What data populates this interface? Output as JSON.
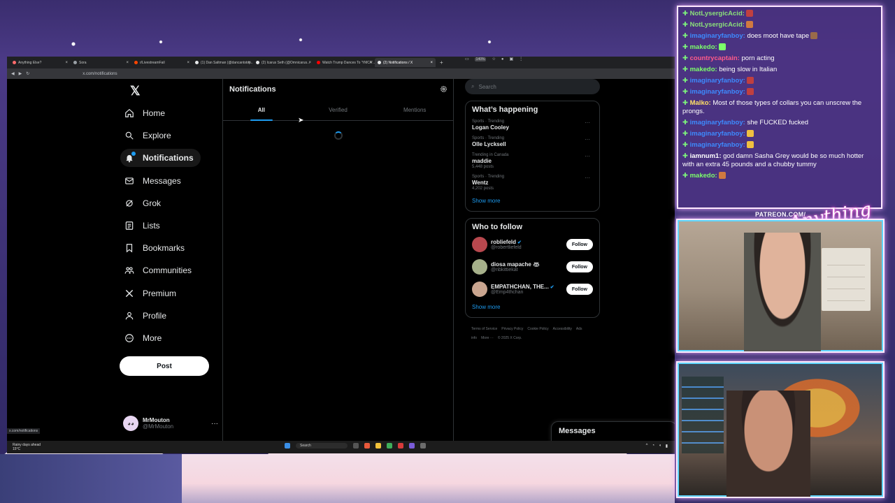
{
  "browser": {
    "tabs": [
      {
        "label": "Anything Else?",
        "color": "#ff6b6b"
      },
      {
        "label": "Sora",
        "color": "#9aa0a6"
      },
      {
        "label": "r/LivestreamFail",
        "color": "#ff4500"
      },
      {
        "label": "(1) Dan Saltman (@dancantstop...",
        "color": "#e7e9ea"
      },
      {
        "label": "(2) Icarus Seth (@Omnicarus...",
        "color": "#e7e9ea"
      },
      {
        "label": "Watch Trump Dances To 'YMCA'...",
        "color": "#ff0000"
      },
      {
        "label": "(2) Notifications / X",
        "color": "#e7e9ea",
        "active": true
      }
    ],
    "url": "x.com/notifications",
    "zoom": "140%",
    "status_url": "x.com/notifications"
  },
  "nav": {
    "items": [
      {
        "label": "Home",
        "icon": "home-icon"
      },
      {
        "label": "Explore",
        "icon": "search-icon"
      },
      {
        "label": "Notifications",
        "icon": "bell-icon",
        "active": true,
        "badge": "2"
      },
      {
        "label": "Messages",
        "icon": "envelope-icon"
      },
      {
        "label": "Grok",
        "icon": "grok-icon"
      },
      {
        "label": "Lists",
        "icon": "list-icon"
      },
      {
        "label": "Bookmarks",
        "icon": "bookmark-icon"
      },
      {
        "label": "Communities",
        "icon": "people-icon"
      },
      {
        "label": "Premium",
        "icon": "x-icon"
      },
      {
        "label": "Profile",
        "icon": "person-icon"
      },
      {
        "label": "More",
        "icon": "more-circle-icon"
      }
    ],
    "post_label": "Post",
    "profile": {
      "name": "MrMouton",
      "handle": "@MrMouton"
    }
  },
  "main": {
    "title": "Notifications",
    "tabs": [
      "All",
      "Verified",
      "Mentions"
    ]
  },
  "right": {
    "search_placeholder": "Search",
    "whats_happening": {
      "title": "What’s happening",
      "trends": [
        {
          "meta": "Sports · Trending",
          "name": "Logan Cooley",
          "count": ""
        },
        {
          "meta": "Sports · Trending",
          "name": "Olle Lycksell",
          "count": ""
        },
        {
          "meta": "Trending in Canada",
          "name": "maddie",
          "count": "5,448 posts"
        },
        {
          "meta": "Sports · Trending",
          "name": "Wentz",
          "count": "4,202 posts"
        }
      ],
      "show_more": "Show more"
    },
    "who_to_follow": {
      "title": "Who to follow",
      "accounts": [
        {
          "name": "robliefeld",
          "handle": "@robertliefeld",
          "verified": true,
          "color": "#b8484e"
        },
        {
          "name": "diosa mapache 🦝",
          "handle": "@nbkittiekat",
          "verified": false,
          "color": "#a6b08a"
        },
        {
          "name": "EMPATHCHAN, THE...",
          "handle": "@Emp4thchan",
          "verified": true,
          "color": "#c9a58f"
        }
      ],
      "follow_label": "Follow",
      "show_more": "Show more"
    },
    "footer": [
      "Terms of Service",
      "Privacy Policy",
      "Cookie Policy",
      "Accessibility",
      "Ads info",
      "More ···",
      "© 2025 X Corp."
    ]
  },
  "messages_drawer": "Messages",
  "taskbar": {
    "weather_line1": "Rainy days ahead",
    "weather_line2": "15°C",
    "search": "Search"
  },
  "chat": [
    {
      "user": "NotLysergicAcid:",
      "text": "",
      "color": "#8be07a",
      "emote": "#c04040"
    },
    {
      "user": "NotLysergicAcid:",
      "text": "",
      "color": "#8be07a",
      "emote": "#d07a40"
    },
    {
      "user": "imaginaryfanboy:",
      "text": "does moot have tape",
      "color": "#3d8bff",
      "emote": "#9a6a4a"
    },
    {
      "user": "makedo:",
      "text": "",
      "color": "#7cff6a",
      "emote": "#7cff6a"
    },
    {
      "user": "countrycaptain:",
      "text": "porn acting",
      "color": "#ff5a8a",
      "emote": ""
    },
    {
      "user": "makedo:",
      "text": "being slow in Italian",
      "color": "#7cff6a",
      "emote": ""
    },
    {
      "user": "imaginaryfanboy:",
      "text": "",
      "color": "#3d8bff",
      "emote": "#c04040"
    },
    {
      "user": "imaginaryfanboy:",
      "text": "",
      "color": "#3d8bff",
      "emote": "#c04040"
    },
    {
      "user": "Malko:",
      "text": "Most of those types of collars you can unscrew the prongs.",
      "color": "#ffe066",
      "emote": ""
    },
    {
      "user": "imaginaryfanboy:",
      "text": "she FUCKED fucked",
      "color": "#3d8bff",
      "emote": ""
    },
    {
      "user": "imaginaryfanboy:",
      "text": "",
      "color": "#3d8bff",
      "emote": "#f0c040"
    },
    {
      "user": "imaginaryfanboy:",
      "text": "",
      "color": "#3d8bff",
      "emote": "#f0c040"
    },
    {
      "user": "iamnum1:",
      "text": "god damn Sasha Grey would be so much hotter with an extra 45 pounds and a chubby tummy",
      "color": "#ffffff",
      "emote": ""
    },
    {
      "user": "makedo:",
      "text": "",
      "color": "#7cff6a",
      "emote": "#d07a40"
    }
  ],
  "overlay": {
    "patreon": "PATREON.COM/",
    "brand": "AnythingElse"
  }
}
